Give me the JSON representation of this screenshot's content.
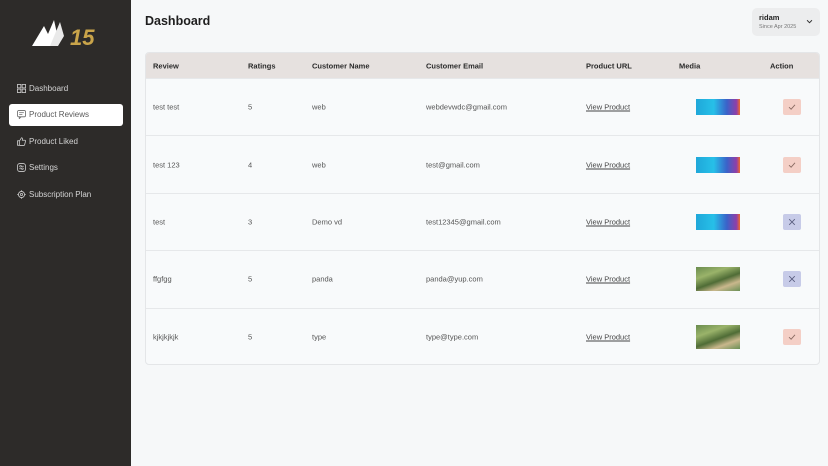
{
  "brand": {
    "logo_text": "15",
    "colors": {
      "sidebar": "#2d2b29",
      "gold": "#c9a44a"
    }
  },
  "sidebar": {
    "items": [
      {
        "label": "Dashboard",
        "icon": "dashboard-icon",
        "active": false
      },
      {
        "label": "Product Reviews",
        "icon": "review-icon",
        "active": true
      },
      {
        "label": "Product Liked",
        "icon": "thumbs-up-icon",
        "active": false
      },
      {
        "label": "Settings",
        "icon": "settings-icon",
        "active": false
      },
      {
        "label": "Subscription Plan",
        "icon": "gear-icon",
        "active": false
      }
    ]
  },
  "header": {
    "title": "Dashboard"
  },
  "user": {
    "name": "ridam",
    "since": "Since Apr 2025",
    "menu_icon": "chevron-down-icon"
  },
  "table": {
    "columns": [
      "Review",
      "Ratings",
      "Customer Name",
      "Customer Email",
      "Product URL",
      "Media",
      "Action"
    ],
    "rows": [
      {
        "review": "test test",
        "rating": "5",
        "name": "web",
        "email": "webdevwdc@gmail.com",
        "url": "View Product",
        "media": "banner",
        "action": "approve"
      },
      {
        "review": "test 123",
        "rating": "4",
        "name": "web",
        "email": "test@gmail.com",
        "url": "View Product",
        "media": "banner",
        "action": "approve"
      },
      {
        "review": "test",
        "rating": "3",
        "name": "Demo vd",
        "email": "test12345@gmail.com",
        "url": "View Product",
        "media": "banner",
        "action": "reject"
      },
      {
        "review": "ffgfgg",
        "rating": "5",
        "name": "panda",
        "email": "panda@yup.com",
        "url": "View Product",
        "media": "photo",
        "action": "reject"
      },
      {
        "review": "kjkjkjkjk",
        "rating": "5",
        "name": "type",
        "email": "type@type.com",
        "url": "View Product",
        "media": "photo",
        "action": "approve"
      }
    ]
  }
}
